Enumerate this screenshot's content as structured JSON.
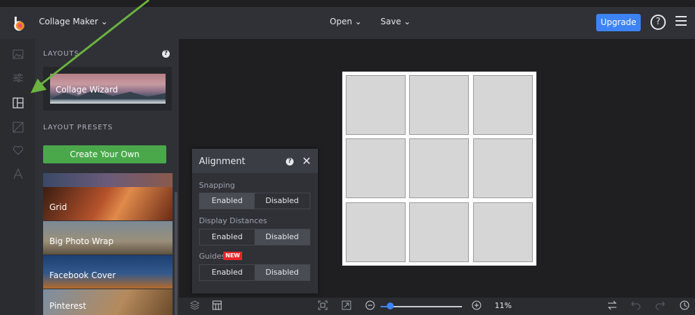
{
  "topbar": {
    "app_select": "Collage Maker ⌄",
    "open_label": "Open ⌄",
    "save_label": "Save ⌄",
    "upgrade_label": "Upgrade",
    "help_glyph": "?"
  },
  "rail": {
    "icons": [
      "image-icon",
      "sliders-icon",
      "layout-icon",
      "frame-icon",
      "heart-icon",
      "text-icon"
    ]
  },
  "panel": {
    "layouts_title": "LAYOUTS",
    "wizard_label": "Collage Wizard",
    "presets_title": "LAYOUT PRESETS",
    "create_label": "Create Your Own",
    "presets": [
      "Grid",
      "Big Photo Wrap",
      "Facebook Cover",
      "Pinterest"
    ]
  },
  "alignment": {
    "title": "Alignment",
    "snapping_label": "Snapping",
    "distances_label": "Display Distances",
    "guides_label": "Guides",
    "new_badge": "NEW",
    "enabled": "Enabled",
    "disabled": "Disabled",
    "close_glyph": "✕"
  },
  "bottombar": {
    "zoom": "11%"
  },
  "colors": {
    "accent": "#3d83f5",
    "create": "#4aa84b",
    "badge": "#e5252a",
    "annotation_arrow": "#6cb33f"
  }
}
